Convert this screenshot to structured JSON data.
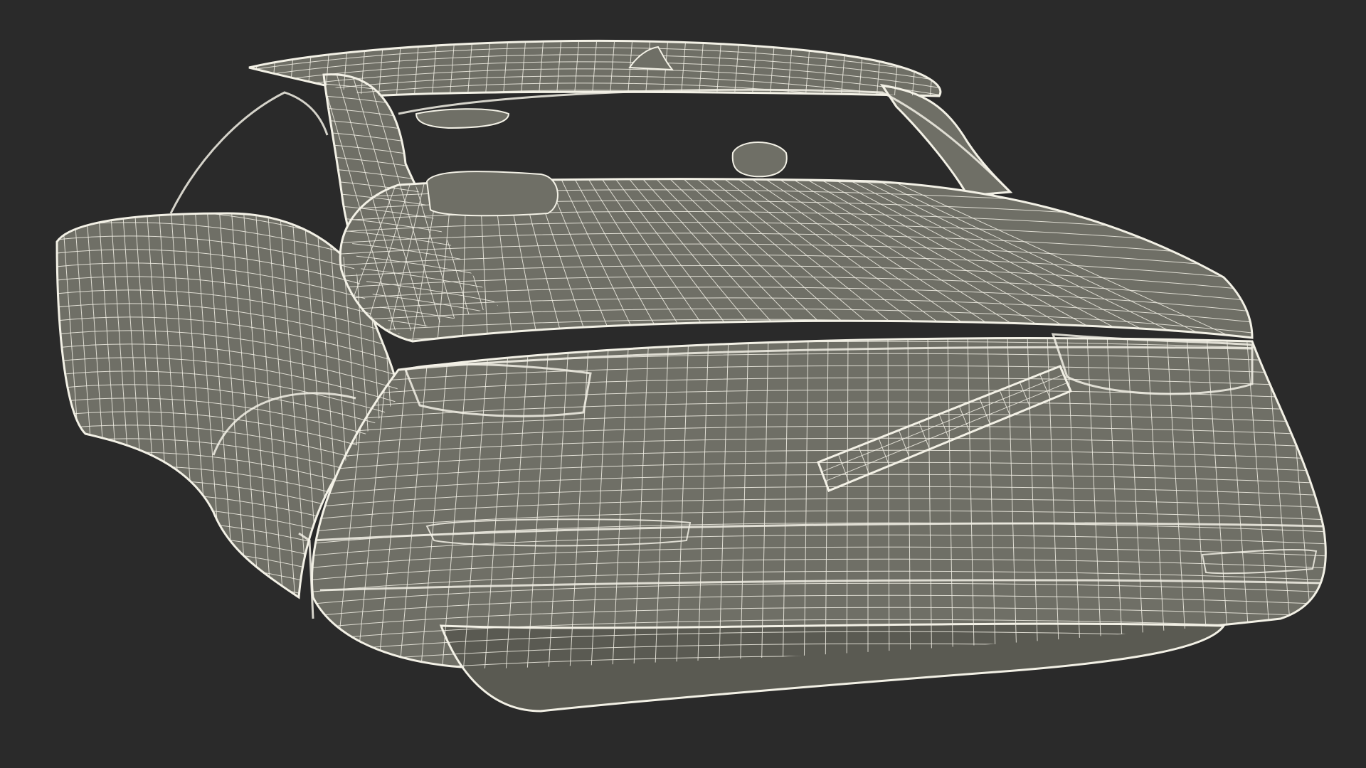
{
  "scene": {
    "background_color": "#2a2a2a",
    "body_color": "#6f6f66",
    "body_dark_color": "#5a5a52",
    "wire_color": "#f3f1e6",
    "glass_color": "#2a2a2a"
  }
}
